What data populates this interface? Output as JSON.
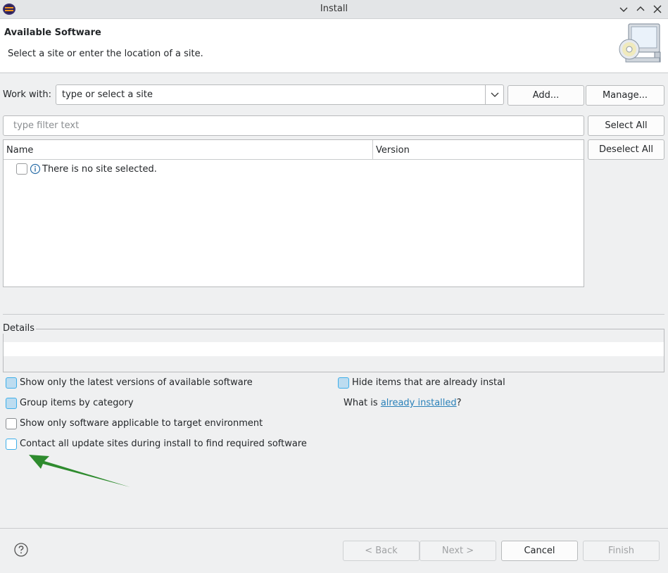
{
  "window": {
    "title": "Install"
  },
  "header": {
    "title": "Available Software",
    "subtitle": "Select a site or enter the location of a site."
  },
  "work_with": {
    "label": "Work with:",
    "combo_value": "type or select a site",
    "add_label": "Add...",
    "manage_label": "Manage..."
  },
  "filter": {
    "placeholder": "type filter text",
    "select_all_label": "Select All",
    "deselect_all_label": "Deselect All"
  },
  "table": {
    "columns": [
      "Name",
      "Version"
    ],
    "rows": [
      {
        "text": "There is no site selected.",
        "checked": false,
        "icon": "info-icon"
      }
    ]
  },
  "details": {
    "label": "Details"
  },
  "options": {
    "latest_versions": {
      "label": "Show only the latest versions of available software",
      "checked": true
    },
    "group_by_category": {
      "label": "Group items by category",
      "checked": true
    },
    "applicable_target": {
      "label": "Show only software applicable to target environment",
      "checked": false
    },
    "contact_sites": {
      "label": "Contact all update sites during install to find required software",
      "checked": false
    },
    "hide_installed": {
      "label": "Hide items that are already installed",
      "checked": true
    },
    "what_is_prefix": "What is ",
    "already_installed_link": "already installed",
    "what_is_suffix": "?"
  },
  "footer": {
    "back_label": "< Back",
    "next_label": "Next >",
    "cancel_label": "Cancel",
    "finish_label": "Finish"
  },
  "colors": {
    "accent": "#3daee9",
    "link": "#2980b9",
    "annotation_arrow": "#2e8b2e"
  }
}
